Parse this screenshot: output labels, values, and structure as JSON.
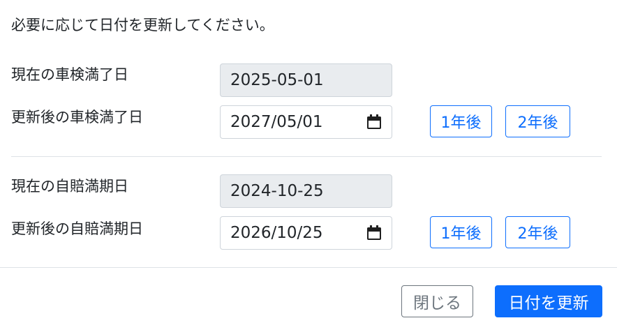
{
  "instruction": "必要に応じて日付を更新してください。",
  "inspection": {
    "current_label": "現在の車検満了日",
    "current_value": "2025-05-01",
    "new_label": "更新後の車検満了日",
    "new_value": "2027/05/01",
    "plus1_label": "1年後",
    "plus2_label": "2年後"
  },
  "insurance": {
    "current_label": "現在の自賠満期日",
    "current_value": "2024-10-25",
    "new_label": "更新後の自賠満期日",
    "new_value": "2026/10/25",
    "plus1_label": "1年後",
    "plus2_label": "2年後"
  },
  "footer": {
    "close_label": "閉じる",
    "update_label": "日付を更新"
  },
  "colors": {
    "primary": "#0d6efd",
    "secondary": "#6c757d",
    "readonly_bg": "#e9ecef",
    "border": "#ced4da"
  }
}
